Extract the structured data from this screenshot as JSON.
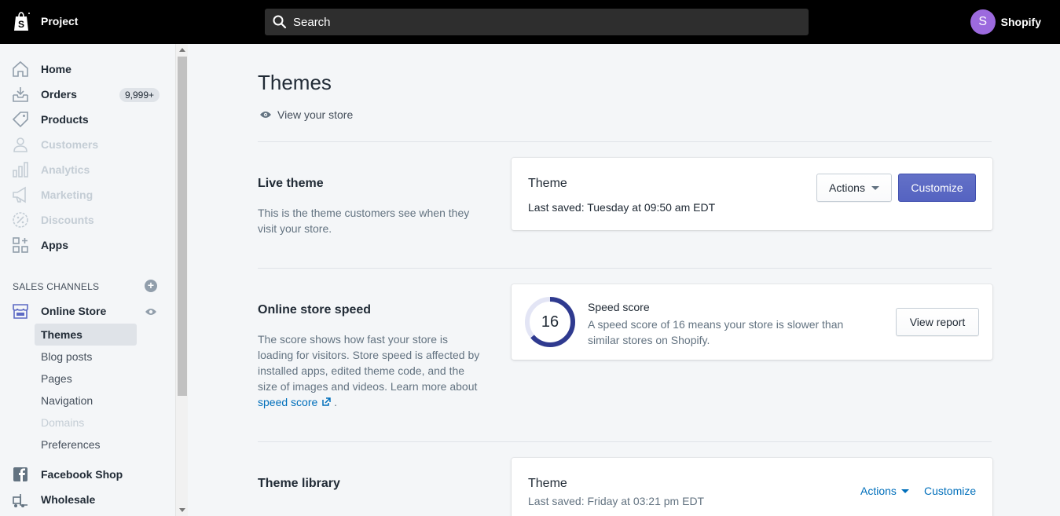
{
  "topbar": {
    "store_name": "Project",
    "search_placeholder": "Search",
    "user_initial": "S",
    "user_name": "Shopify"
  },
  "sidebar": {
    "items": [
      {
        "label": "Home",
        "icon": "home-icon",
        "enabled": true
      },
      {
        "label": "Orders",
        "icon": "orders-icon",
        "enabled": true,
        "badge": "9,999+"
      },
      {
        "label": "Products",
        "icon": "tag-icon",
        "enabled": true
      },
      {
        "label": "Customers",
        "icon": "person-icon",
        "enabled": false
      },
      {
        "label": "Analytics",
        "icon": "bar-chart-icon",
        "enabled": false
      },
      {
        "label": "Marketing",
        "icon": "megaphone-icon",
        "enabled": false
      },
      {
        "label": "Discounts",
        "icon": "discount-icon",
        "enabled": false
      },
      {
        "label": "Apps",
        "icon": "apps-icon",
        "enabled": true
      }
    ],
    "sales_channels_title": "SALES CHANNELS",
    "online_store": {
      "label": "Online Store",
      "sub_items": [
        "Themes",
        "Blog posts",
        "Pages",
        "Navigation",
        "Domains",
        "Preferences"
      ],
      "active": "Themes",
      "disabled": [
        "Domains"
      ]
    },
    "facebook_shop": "Facebook Shop",
    "wholesale": "Wholesale"
  },
  "main": {
    "title": "Themes",
    "view_store": "View your store",
    "live_theme": {
      "heading": "Live theme",
      "description": "This is the theme customers see when they visit your store.",
      "card_title": "Theme",
      "last_saved": "Last saved: Tuesday at 09:50 am EDT",
      "actions_label": "Actions",
      "customize_label": "Customize"
    },
    "speed": {
      "heading": "Online store speed",
      "description_pre": "The score shows how fast your store is loading for visitors. Store speed is affected by installed apps, edited theme code, and the size of images and videos. Learn more about",
      "link_text": "speed score",
      "description_post": ".",
      "score": "16",
      "score_fraction": 0.64,
      "card_title": "Speed score",
      "card_desc": "A speed score of 16 means your store is slower than similar stores on Shopify.",
      "view_report_label": "View report"
    },
    "library": {
      "heading": "Theme library",
      "card_title": "Theme",
      "last_saved": "Last saved: Friday at 03:21 pm EDT",
      "actions_label": "Actions",
      "customize_label": "Customize"
    }
  },
  "colors": {
    "primary": "#5c6ac4",
    "link": "#006fbb",
    "avatar": "#9c6ade",
    "topbar": "#000000"
  }
}
